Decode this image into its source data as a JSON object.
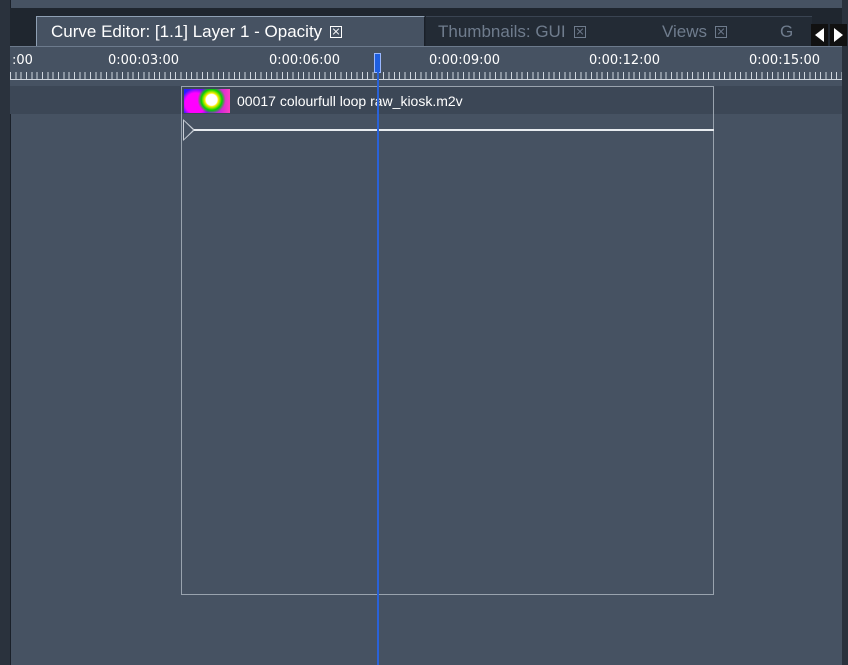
{
  "tabs": {
    "active": {
      "label": "Curve Editor: [1.1] Layer 1 - Opacity"
    },
    "thumbnails": {
      "label": "Thumbnails: GUI"
    },
    "views": {
      "label": "Views"
    },
    "g": {
      "label": "G"
    }
  },
  "ruler": {
    "labels": [
      ":00",
      "0:00:03:00",
      "0:00:06:00",
      "0:00:09:00",
      "0:00:12:00",
      "0:00:15:00"
    ]
  },
  "clip": {
    "title": "00017 colourfull loop raw_kiosk.m2v"
  },
  "colors": {
    "background": "#465262",
    "playhead": "#2a62d8",
    "tab_bar": "#1f262f"
  }
}
